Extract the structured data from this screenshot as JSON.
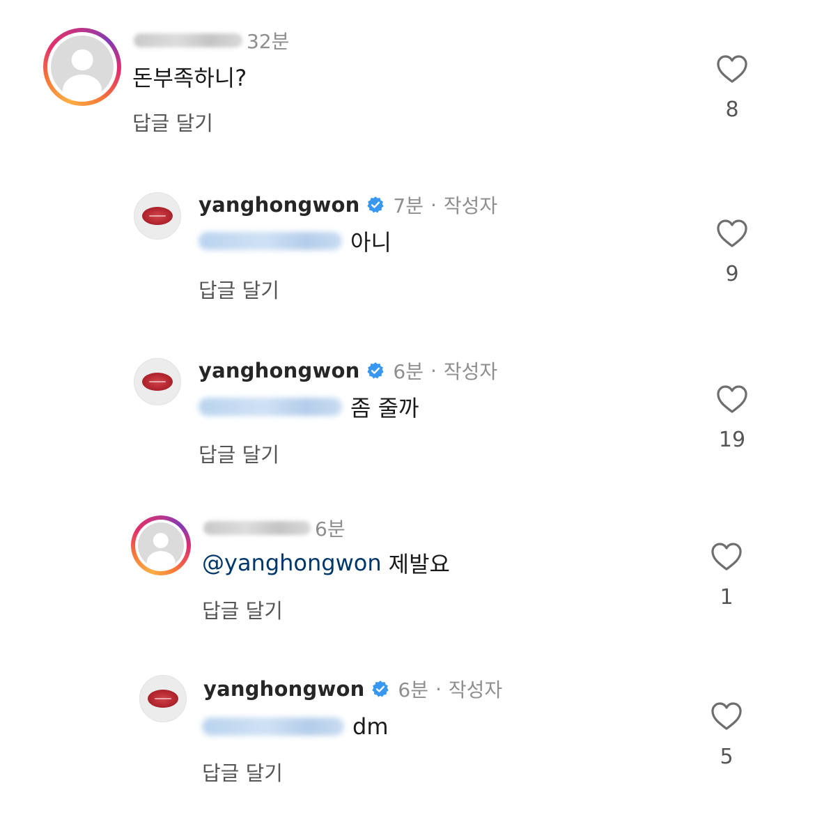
{
  "comments": [
    {
      "username_blurred": true,
      "time": "32분",
      "text": "돈부족하니?",
      "reply_label": "답글 달기",
      "likes": "8"
    },
    {
      "username": "yanghongwon",
      "verified": true,
      "time": "7분",
      "separator": "·",
      "author_tag": "작성자",
      "mention_blurred": true,
      "text": "아니",
      "reply_label": "답글 달기",
      "likes": "9"
    },
    {
      "username": "yanghongwon",
      "verified": true,
      "time": "6분",
      "separator": "·",
      "author_tag": "작성자",
      "mention_blurred": true,
      "text": "좀 줄까",
      "reply_label": "답글 달기",
      "likes": "19"
    },
    {
      "username_blurred": true,
      "time": "6분",
      "mention": "@yanghongwon",
      "text": "제발요",
      "reply_label": "답글 달기",
      "likes": "1"
    },
    {
      "username": "yanghongwon",
      "verified": true,
      "time": "6분",
      "separator": "·",
      "author_tag": "작성자",
      "mention_blurred": true,
      "text": "dm",
      "reply_label": "답글 달기",
      "likes": "5"
    }
  ],
  "icons": {
    "like": "heart-outline-icon",
    "verified": "verified-badge-icon",
    "default_avatar": "default-avatar-icon"
  },
  "colors": {
    "verified_blue": "#3897f0",
    "mention_blue": "#00376b",
    "secondary_text": "#8e8e8e"
  }
}
